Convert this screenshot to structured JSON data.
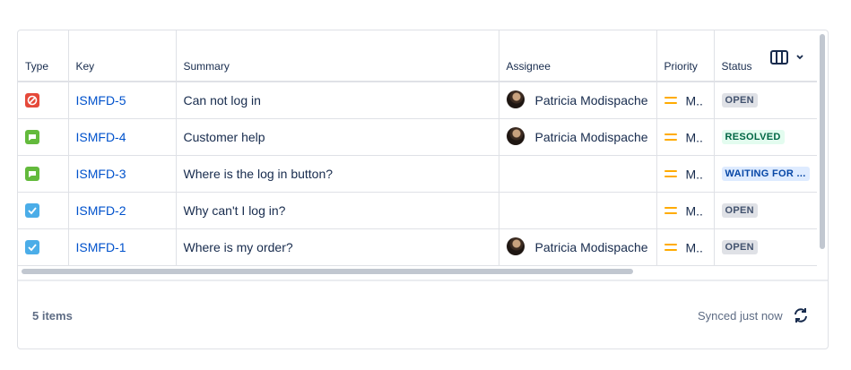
{
  "columns": {
    "type": "Type",
    "key": "Key",
    "summary": "Summary",
    "assignee": "Assignee",
    "priority": "Priority",
    "status": "Status"
  },
  "rows": [
    {
      "type_icon": "block-icon",
      "type_color": "#e5493a",
      "key": "ISMFD-5",
      "summary": "Can not log in",
      "assignee": "Patricia Modispache",
      "priority": "M..",
      "status": "OPEN",
      "status_kind": "open"
    },
    {
      "type_icon": "chat-icon",
      "type_color": "#63ba3c",
      "key": "ISMFD-4",
      "summary": "Customer help",
      "assignee": "Patricia Modispache",
      "priority": "M..",
      "status": "RESOLVED",
      "status_kind": "resolved"
    },
    {
      "type_icon": "chat-icon",
      "type_color": "#63ba3c",
      "key": "ISMFD-3",
      "summary": "Where is the log in button?",
      "assignee": "",
      "priority": "M..",
      "status": "WAITING FOR ...",
      "status_kind": "waiting"
    },
    {
      "type_icon": "checkbox-icon",
      "type_color": "#4bade8",
      "key": "ISMFD-2",
      "summary": "Why can't I log in?",
      "assignee": "",
      "priority": "M..",
      "status": "OPEN",
      "status_kind": "open"
    },
    {
      "type_icon": "checkbox-icon",
      "type_color": "#4bade8",
      "key": "ISMFD-1",
      "summary": "Where is my order?",
      "assignee": "Patricia Modispache",
      "priority": "M..",
      "status": "OPEN",
      "status_kind": "open"
    }
  ],
  "footer": {
    "count": "5 items",
    "synced": "Synced just now"
  },
  "colors": {
    "link": "#0052cc",
    "priority_medium": "#ffab00"
  }
}
